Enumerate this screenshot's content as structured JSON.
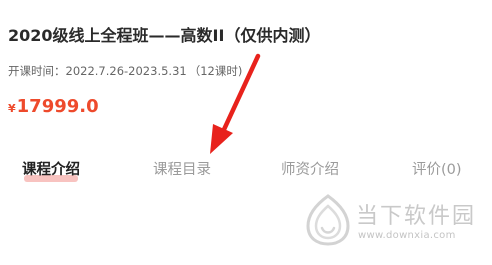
{
  "course": {
    "title": "2020级线上全程班——高数II（仅供内测）",
    "period_label": "开课时间：",
    "period_value": "2022.7.26-2023.5.31",
    "lesson_count": "（12课时)",
    "price_currency": "¥",
    "price_amount": "17999.0"
  },
  "tabs": [
    {
      "label": "课程介绍",
      "active": true
    },
    {
      "label": "课程目录",
      "active": false
    },
    {
      "label": "师资介绍",
      "active": false
    },
    {
      "label": "评价(0)",
      "active": false
    }
  ],
  "annotation": {
    "arrow_color": "#e8221c"
  },
  "watermark": {
    "name": "当下软件园",
    "url": "www.downxia.com"
  },
  "colors": {
    "price": "#ee4a2c",
    "active_tab_highlight": "#f8c3c0",
    "inactive_tab": "#9b9b9b"
  }
}
